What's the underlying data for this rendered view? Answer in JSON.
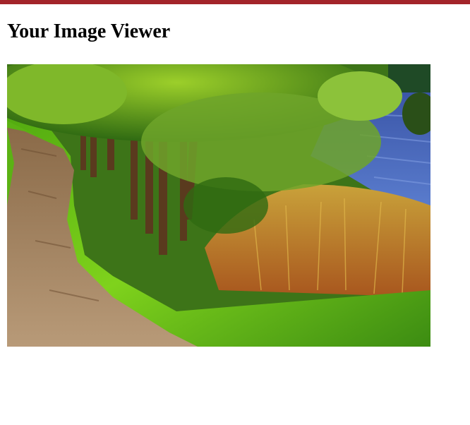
{
  "header": {
    "title": "Your Image Viewer",
    "accent_color": "#a3242a"
  },
  "viewer": {
    "image_subject": "landscape-photo-path-lake-trees"
  }
}
